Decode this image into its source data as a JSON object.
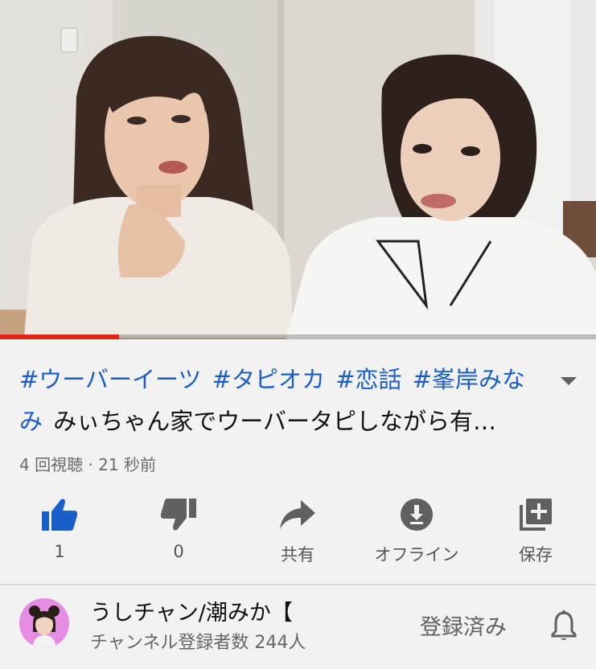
{
  "video": {
    "progress_fraction": 0.2
  },
  "title": {
    "hashtags": [
      "#ウーバーイーツ",
      "#タピオカ",
      "#恋話",
      "#峯岸みな"
    ],
    "line2_hashtag_tail": "み",
    "line2_text": "みぃちゃん家でウーバータピしながら有…"
  },
  "meta": {
    "views": "4 回視聴 · 21 秒前"
  },
  "actions": {
    "like_count": "1",
    "dislike_count": "0",
    "share_label": "共有",
    "offline_label": "オフライン",
    "save_label": "保存"
  },
  "channel": {
    "name": "うしチャン/潮みか【",
    "subscribers": "チャンネル登録者数 244人",
    "subscribed_label": "登録済み"
  },
  "colors": {
    "accent_blue": "#1a5fc9",
    "progress_red": "#e62117",
    "avatar_pink": "#e58ce3"
  },
  "icons": [
    "like-icon",
    "dislike-icon",
    "share-icon",
    "download-icon",
    "playlist-add-icon",
    "chevron-down-icon",
    "bell-icon"
  ]
}
